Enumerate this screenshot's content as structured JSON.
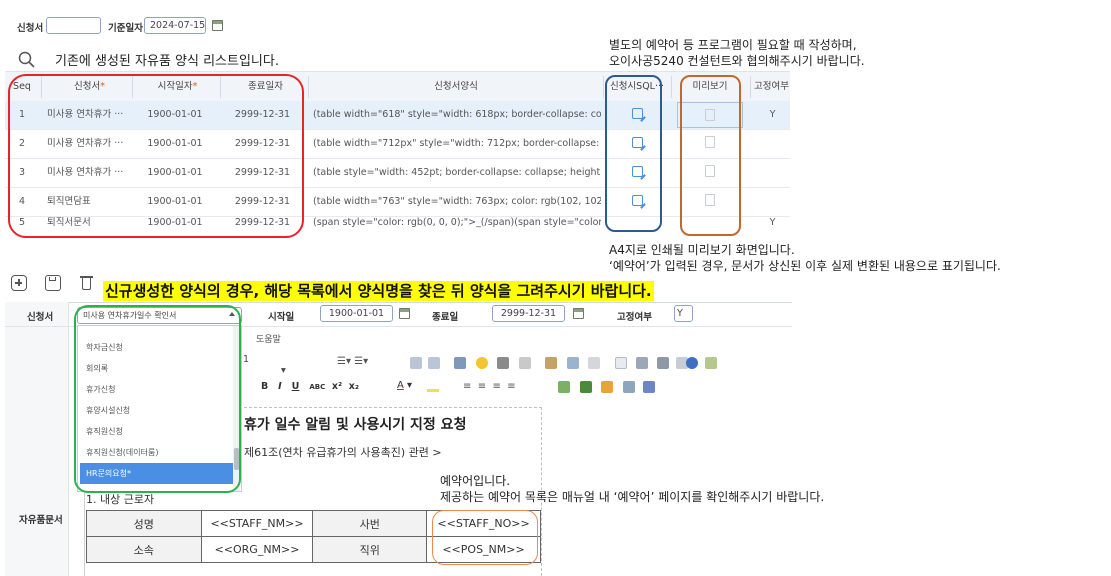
{
  "filter": {
    "applicant_label": "신청서",
    "applicant_value": "",
    "base_date_label": "기준일자",
    "base_date_value": "2024-07-15"
  },
  "list_caption": "기존에 생성된 자유품 양식 리스트입니다.",
  "grid": {
    "columns": [
      "Seq",
      "신청서",
      "시작일자",
      "종료일자",
      "신청서양식",
      "신청시SQL···",
      "미리보기",
      "고정여부"
    ],
    "required_mark": "*",
    "rows": [
      {
        "seq": "1",
        "name": "미사용 연차휴가 ···",
        "start": "1900-01-01",
        "end": "2999-12-31",
        "form": "(table width=\"618\" style=\"width: 618px; border-collapse: colla···",
        "fixed": "Y"
      },
      {
        "seq": "2",
        "name": "미사용 연차휴가 ···",
        "start": "1900-01-01",
        "end": "2999-12-31",
        "form": "(table width=\"712px\" style=\"width: 712px; border-collapse: cor···",
        "fixed": ""
      },
      {
        "seq": "3",
        "name": "미사용 연차휴가 ···",
        "start": "1900-01-01",
        "end": "2999-12-31",
        "form": "(table style=\"width: 452pt; border-collapse: collapse; height: ···",
        "fixed": ""
      },
      {
        "seq": "4",
        "name": "퇴직면담표",
        "start": "1900-01-01",
        "end": "2999-12-31",
        "form": "(table width=\"763\" style=\"width: 763px; color: rgb(102, 102, 1···",
        "fixed": ""
      },
      {
        "seq": "5",
        "name": "퇴직서문서",
        "start": "1900-01-01",
        "end": "2999-12-31",
        "form": "(span style=\"color: rgb(0, 0, 0);\">_(/span)(span style=\"color: r···",
        "fixed": "Y"
      }
    ]
  },
  "notes": {
    "sql_note_1": "별도의 예약어 등 프로그램이 필요할 때 작성하며,",
    "sql_note_2": "오이사공5240 컨설턴트와 협의해주시기 바랍니다.",
    "preview_note_1": "A4지로 인쇄될 미리보기 화면입니다.",
    "preview_note_2": "‘예약어’가 입력된 경우, 문서가 상신된 이후 실제 변환된 내용으로 표기됩니다.",
    "highlight": "신규생성한 양식의 경우, 해당 목록에서 양식명을 찾은 뒤 양식을 그려주시기 바랍니다.",
    "reserved_1": "예약어입니다.",
    "reserved_2": "제공하는 예약어 목록은 매뉴얼 내 ‘예약어’ 페이지를 확인해주시기 바랍니다."
  },
  "form": {
    "applicant_label": "신청서",
    "applicant_value": "미사용 연차휴가일수 확인서",
    "start_label": "시작일",
    "start_value": "1900-01-01",
    "end_label": "종료일",
    "end_value": "2999-12-31",
    "fixed_label": "고정여부",
    "fixed_value": "Y",
    "free_doc_label": "자유품문서",
    "help_tab": "도움말",
    "font_size": "1"
  },
  "dropdown_options": [
    "학자금신청",
    "회의록",
    "휴가신청",
    "휴양시설신청",
    "휴직원신청",
    "휴직원신청(데이터룸)",
    "HR문의요청*"
  ],
  "document": {
    "title": "휴가 일수 알림 및 사용시기 지정 요청",
    "article": "제61조(연차 유급휴가의 사용촉진) 관련 >",
    "section": "1. 내상 근로자",
    "table": [
      [
        "성명",
        "<<STAFF_NM>>",
        "사번",
        "<<STAFF_NO>>"
      ],
      [
        "소속",
        "<<ORG_NM>>",
        "직위",
        "<<POS_NM>>"
      ]
    ]
  },
  "colors": {
    "red_box": "#e8232a",
    "blue_box": "#2d5b8f",
    "orange_box": "#c0692a",
    "green_box": "#2db14f",
    "highlight": "#ffff00",
    "selected_row": "#e6f0fb"
  }
}
